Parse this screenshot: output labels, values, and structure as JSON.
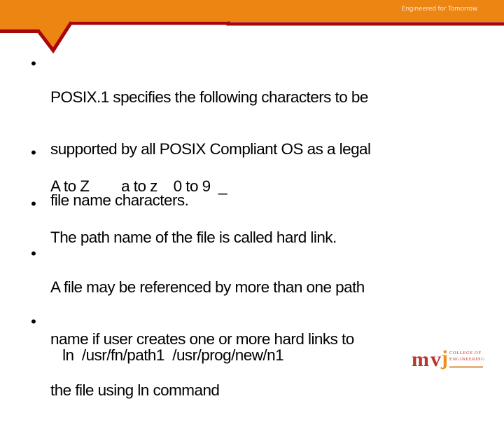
{
  "header": {
    "tagline": "Engineered for Tomorrow",
    "colors": {
      "banner": "#ec8512",
      "stripe": "#a8070a"
    }
  },
  "slide": {
    "bullets": [
      {
        "lines": [
          "POSIX.1 specifies the following characters to be",
          "supported by all POSIX Compliant OS as a legal",
          "file name characters."
        ]
      },
      {
        "lines": [
          "A to Z        a to z    0 to 9  _"
        ]
      },
      {
        "lines": [
          "The path name of the file is called hard link."
        ]
      },
      {
        "lines": [
          "A file may be referenced by more than one path",
          "name if user creates one or more hard links to",
          "the file using ln command"
        ]
      },
      {
        "lines": [
          "   ln  /usr/fn/path1  /usr/prog/new/n1"
        ]
      }
    ]
  },
  "logo": {
    "mark_letters": [
      "m",
      "v",
      "j"
    ],
    "name_line1": "COLLEGE OF",
    "name_line2": "ENGINEERING",
    "colors": {
      "primary": "#b8362a",
      "accent": "#ec8f1c"
    }
  }
}
